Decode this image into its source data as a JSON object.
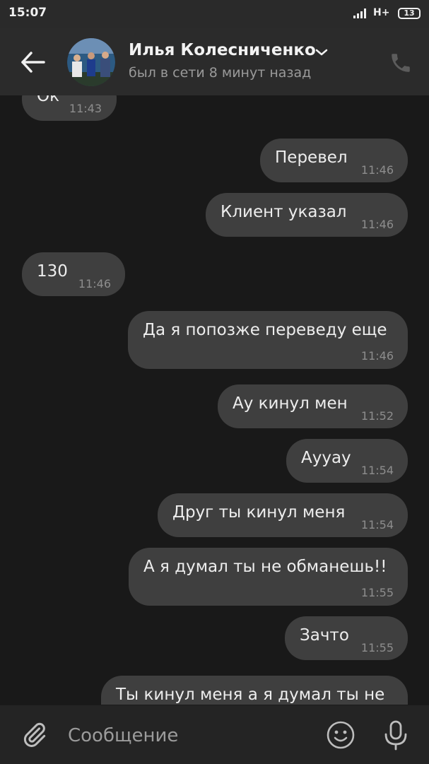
{
  "status_bar": {
    "time": "15:07",
    "network": "H+",
    "battery": "13"
  },
  "header": {
    "contact_name": "Илья Колесниченко",
    "last_seen": "был в сети 8 минут назад"
  },
  "messages": [
    {
      "text": "Ок",
      "time": "11:43",
      "side": "left"
    },
    {
      "text": "Перевел",
      "time": "11:46",
      "side": "right"
    },
    {
      "text": "Клиент указал",
      "time": "11:46",
      "side": "right"
    },
    {
      "text": "130",
      "time": "11:46",
      "side": "left"
    },
    {
      "text": "Да я попозже переведу еще",
      "time": "11:46",
      "side": "right"
    },
    {
      "text": "Ау кинул мен",
      "time": "11:52",
      "side": "right"
    },
    {
      "text": "Ауyay",
      "time": "11:54",
      "side": "right"
    },
    {
      "text": "Друг ты кинул меня",
      "time": "11:54",
      "side": "right"
    },
    {
      "text": "А я думал ты не обманешь!!",
      "time": "11:55",
      "side": "right"
    },
    {
      "text": "Зачто",
      "time": "11:55",
      "side": "right"
    },
    {
      "text": "Ты кинул меня а я думал ты не",
      "time": "",
      "side": "right"
    }
  ],
  "composer": {
    "placeholder": "Сообщение"
  }
}
